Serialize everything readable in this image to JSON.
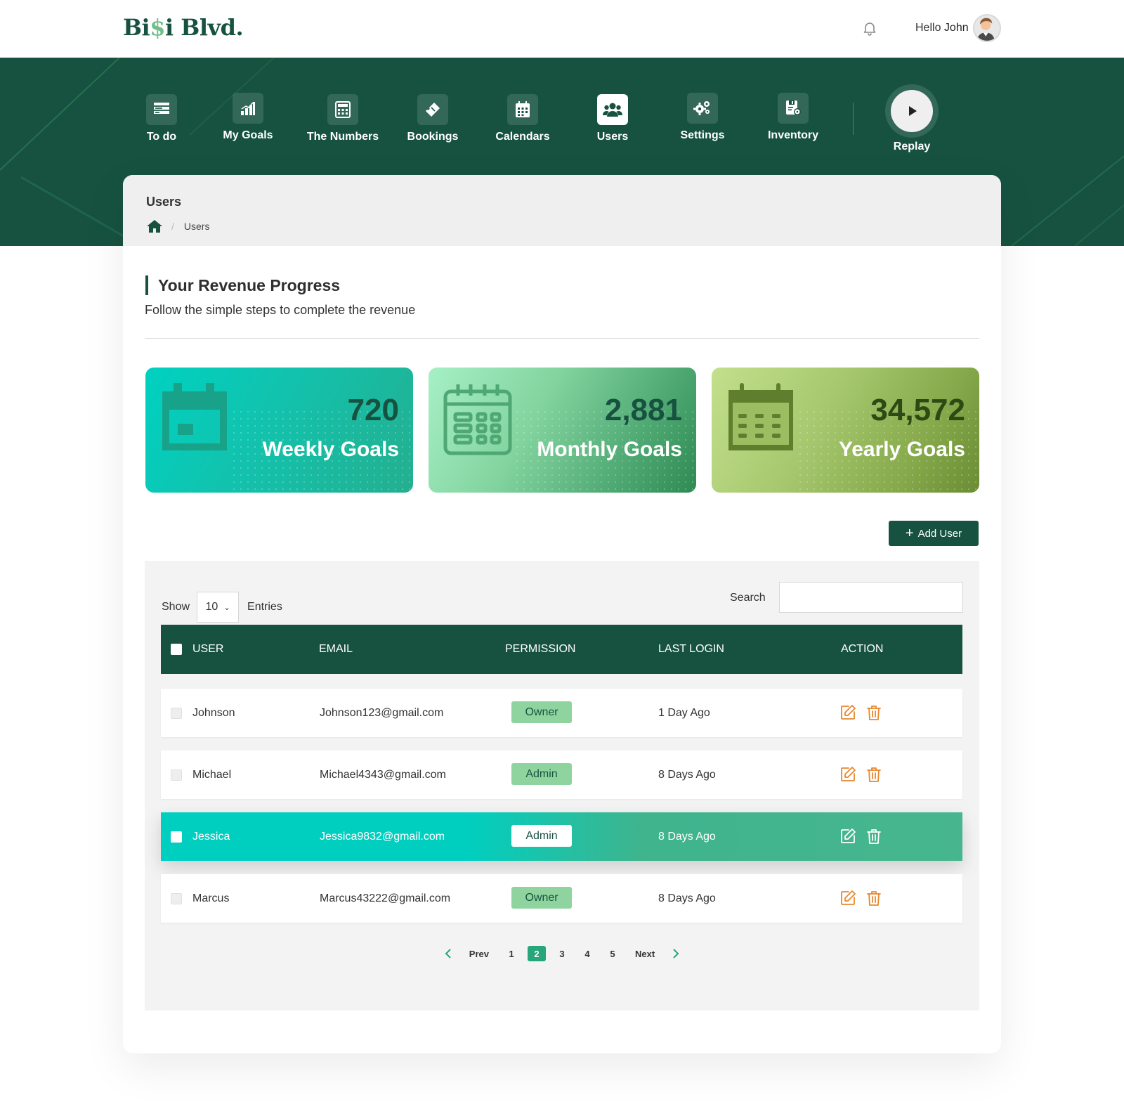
{
  "brand": {
    "logo_prefix": "Bi",
    "logo_dollar": "$",
    "logo_suffix": "i Blvd."
  },
  "header": {
    "greeting": "Hello",
    "user_name": "John"
  },
  "nav": {
    "items": [
      {
        "label": "To do",
        "icon": "todo-list-icon"
      },
      {
        "label": "My Goals",
        "icon": "goals-chart-icon"
      },
      {
        "label": "The Numbers",
        "icon": "calculator-icon"
      },
      {
        "label": "Bookings",
        "icon": "ticket-icon"
      },
      {
        "label": "Calendars",
        "icon": "calendar-icon"
      },
      {
        "label": "Users",
        "icon": "users-icon",
        "active": true
      },
      {
        "label": "Settings",
        "icon": "gears-icon"
      },
      {
        "label": "Inventory",
        "icon": "inventory-icon"
      }
    ],
    "replay_label": "Replay"
  },
  "page": {
    "title": "Users",
    "breadcrumb": [
      "Users"
    ]
  },
  "section": {
    "title": "Your Revenue Progress",
    "subtitle": "Follow the simple steps to complete the revenue"
  },
  "stats": [
    {
      "value": "720",
      "label": "Weekly Goals",
      "icon": "calendar-icon"
    },
    {
      "value": "2,881",
      "label": "Monthly Goals",
      "icon": "calendar-grid-icon"
    },
    {
      "value": "34,572",
      "label": "Yearly Goals",
      "icon": "calendar-icon"
    }
  ],
  "add_user_label": "Add User",
  "table": {
    "show_label": "Show",
    "entries_value": "10",
    "entries_label": "Entries",
    "search_label": "Search",
    "search_value": "",
    "columns": [
      "USER",
      "EMAIL",
      "PERMISSION",
      "LAST LOGIN",
      "ACTION"
    ],
    "rows": [
      {
        "user": "Johnson",
        "email": "Johnson123@gmail.com",
        "permission": "Owner",
        "last_login": "1 Day Ago"
      },
      {
        "user": "Michael",
        "email": "Michael4343@gmail.com",
        "permission": "Admin",
        "last_login": "8 Days Ago"
      },
      {
        "user": "Jessica",
        "email": "Jessica9832@gmail.com",
        "permission": "Admin",
        "last_login": "8 Days Ago",
        "selected": true
      },
      {
        "user": "Marcus",
        "email": "Marcus43222@gmail.com",
        "permission": "Owner",
        "last_login": "8 Days Ago"
      }
    ]
  },
  "pagination": {
    "prev": "Prev",
    "next": "Next",
    "pages": [
      "1",
      "2",
      "3",
      "4",
      "5"
    ],
    "current": "2"
  },
  "colors": {
    "brand_green": "#175240",
    "accent_teal": "#00cfc0",
    "action_orange": "#e8872c",
    "badge_green": "#8fd49e"
  }
}
